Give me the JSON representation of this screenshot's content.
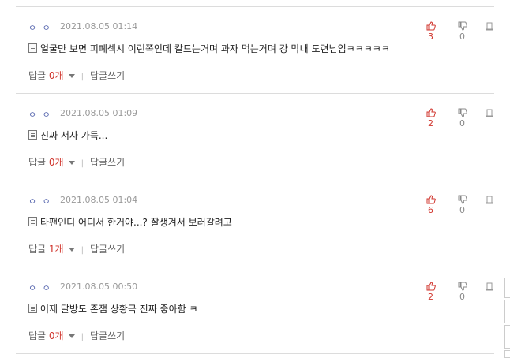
{
  "comments": [
    {
      "nick": "ㅇ ㅇ",
      "date": "2021.08.05 01:14",
      "up": "3",
      "down": "0",
      "text": "얼굴만 보면 피폐섹시 이런쪽인데 칼드는거며 과자 먹는거며 걍 막내 도련님임ㅋㅋㅋㅋㅋ",
      "reply_label": "답글",
      "reply_count": "0개",
      "write_label": "답글쓰기"
    },
    {
      "nick": "ㅇ ㅇ",
      "date": "2021.08.05 01:09",
      "up": "2",
      "down": "0",
      "text": "진짜 서사 가득...",
      "reply_label": "답글",
      "reply_count": "0개",
      "write_label": "답글쓰기"
    },
    {
      "nick": "ㅇ ㅇ",
      "date": "2021.08.05 01:04",
      "up": "6",
      "down": "0",
      "text": "타팬인디 어디서 한거야...? 잘생겨서 보러갈려고",
      "reply_label": "답글",
      "reply_count": "1개",
      "write_label": "답글쓰기"
    },
    {
      "nick": "ㅇ ㅇ",
      "date": "2021.08.05 00:50",
      "up": "2",
      "down": "0",
      "text": "어제 달방도 존잼 상황극 진짜 좋아함 ㅋ",
      "reply_label": "답글",
      "reply_count": "0개",
      "write_label": "답글쓰기"
    }
  ],
  "icons": {
    "up": "thumbs-up-icon",
    "down": "thumbs-down-icon",
    "report": "report-icon",
    "doc": "document-icon"
  },
  "colors": {
    "up_accent": "#d0342c",
    "reply_count": "#d0342c",
    "nick": "#5b6ab0"
  }
}
